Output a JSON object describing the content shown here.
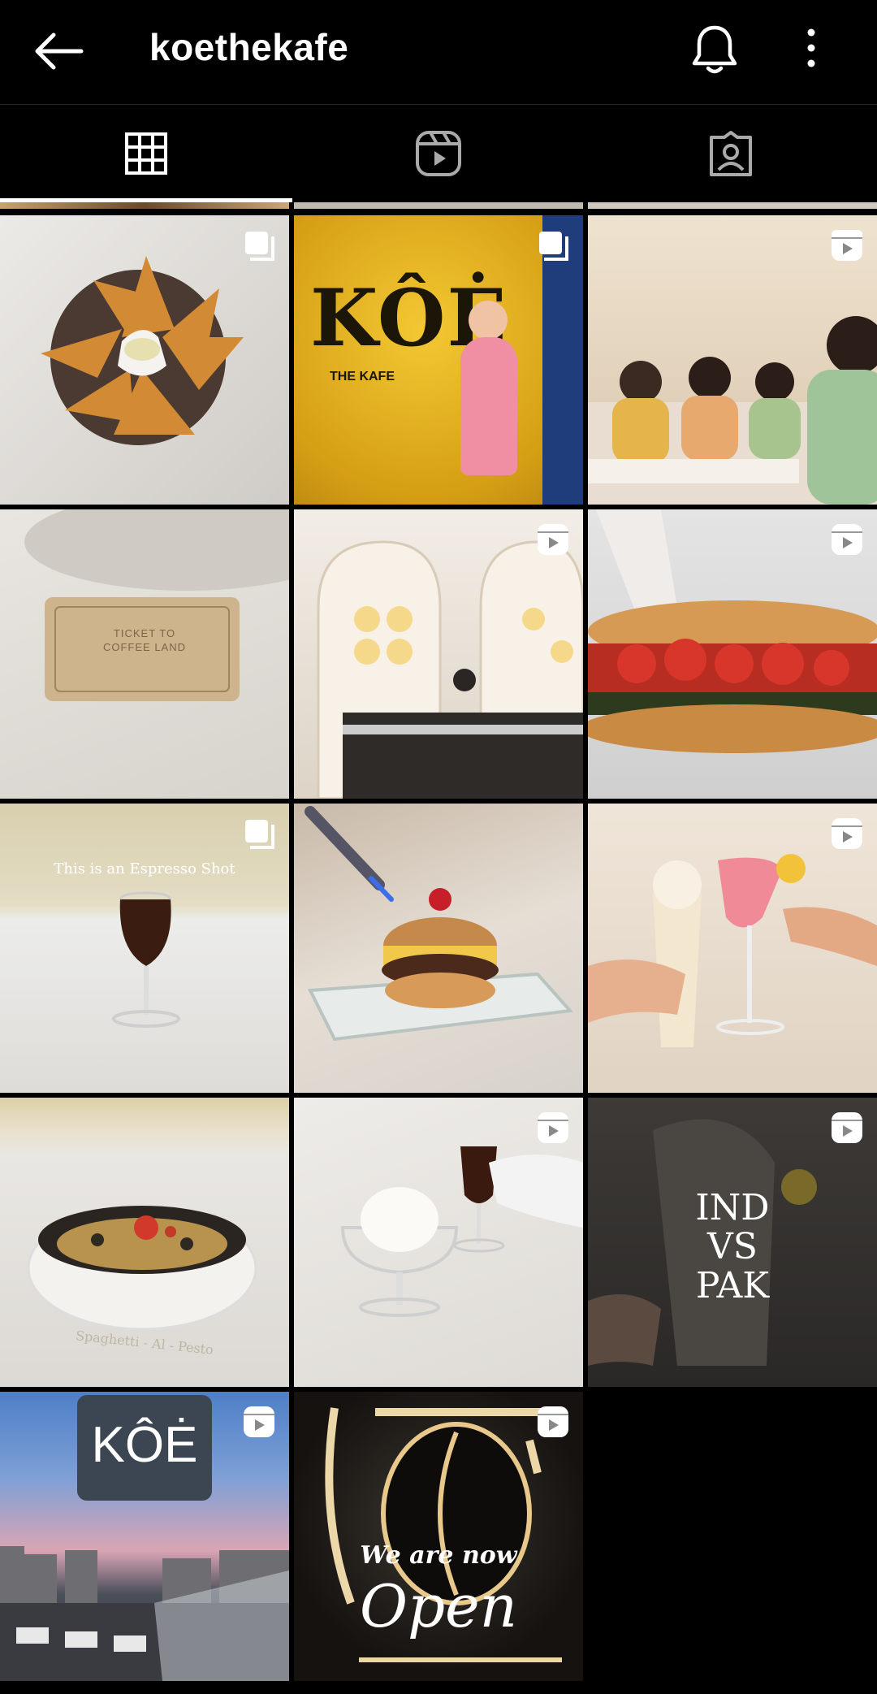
{
  "header": {
    "username": "koethekafe",
    "back_icon": "arrow-left-icon",
    "notification_icon": "bell-icon",
    "more_icon": "more-vertical-icon"
  },
  "tabs": [
    {
      "name": "posts",
      "icon": "grid-icon",
      "selected": true
    },
    {
      "name": "reels",
      "icon": "reels-icon",
      "selected": false
    },
    {
      "name": "tagged",
      "icon": "tagged-icon",
      "selected": false
    }
  ],
  "posts": [
    {
      "badge": "carousel-icon"
    },
    {
      "badge": "carousel-icon",
      "text": [
        "KÔĖ",
        "THE KAFE"
      ]
    },
    {
      "badge": "reel-icon"
    },
    {
      "badge": null,
      "text": [
        "TICKET TO",
        "COFFEE LAND"
      ]
    },
    {
      "badge": "reel-icon"
    },
    {
      "badge": "reel-icon"
    },
    {
      "badge": "carousel-icon",
      "text": [
        "This is an Espresso Shot"
      ]
    },
    {
      "badge": null
    },
    {
      "badge": "reel-icon"
    },
    {
      "badge": null,
      "text": [
        "Spaghetti - Al - Pesto"
      ]
    },
    {
      "badge": "reel-icon"
    },
    {
      "badge": "reel-icon",
      "text": [
        "IND",
        "VS",
        "PAK"
      ]
    },
    {
      "badge": "reel-icon",
      "text": [
        "KÔĖ"
      ]
    },
    {
      "badge": "reel-icon",
      "text": [
        "We are now",
        "Open"
      ]
    }
  ],
  "colors": {
    "background": "#000000",
    "text": "#ffffff"
  }
}
